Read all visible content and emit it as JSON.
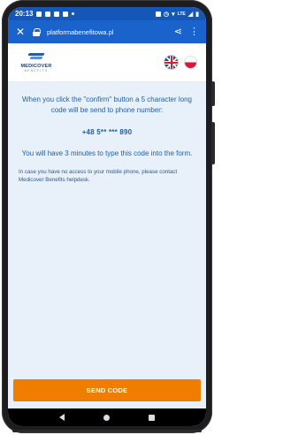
{
  "status_bar": {
    "time": "20:13",
    "signal_text": "LTE"
  },
  "browser": {
    "url": "platformabenefitowa.pl",
    "close_icon": "close-icon",
    "share_icon": "share-icon",
    "more_icon": "more-vert-icon"
  },
  "site": {
    "logo_name": "MEDICOVER",
    "logo_sub": "BENEFITS",
    "languages": [
      "English",
      "Polski"
    ]
  },
  "main": {
    "instruction": "When you click the \"confirm\" button a 5 character long code will be send to phone number:",
    "phone_number": "+48 5** *** 890",
    "timer_note": "You will have 3 minutes to type this code into the form.",
    "help_note": "In case you have no access to your mobile phone, please contact Medicover Benefits helpdesk."
  },
  "actions": {
    "send_code": "SEND CODE"
  },
  "colors": {
    "browser_bar": "#1a63cc",
    "content_bg": "#e8f1f9",
    "text_blue": "#1b5fa8",
    "button_orange": "#f07d00"
  }
}
